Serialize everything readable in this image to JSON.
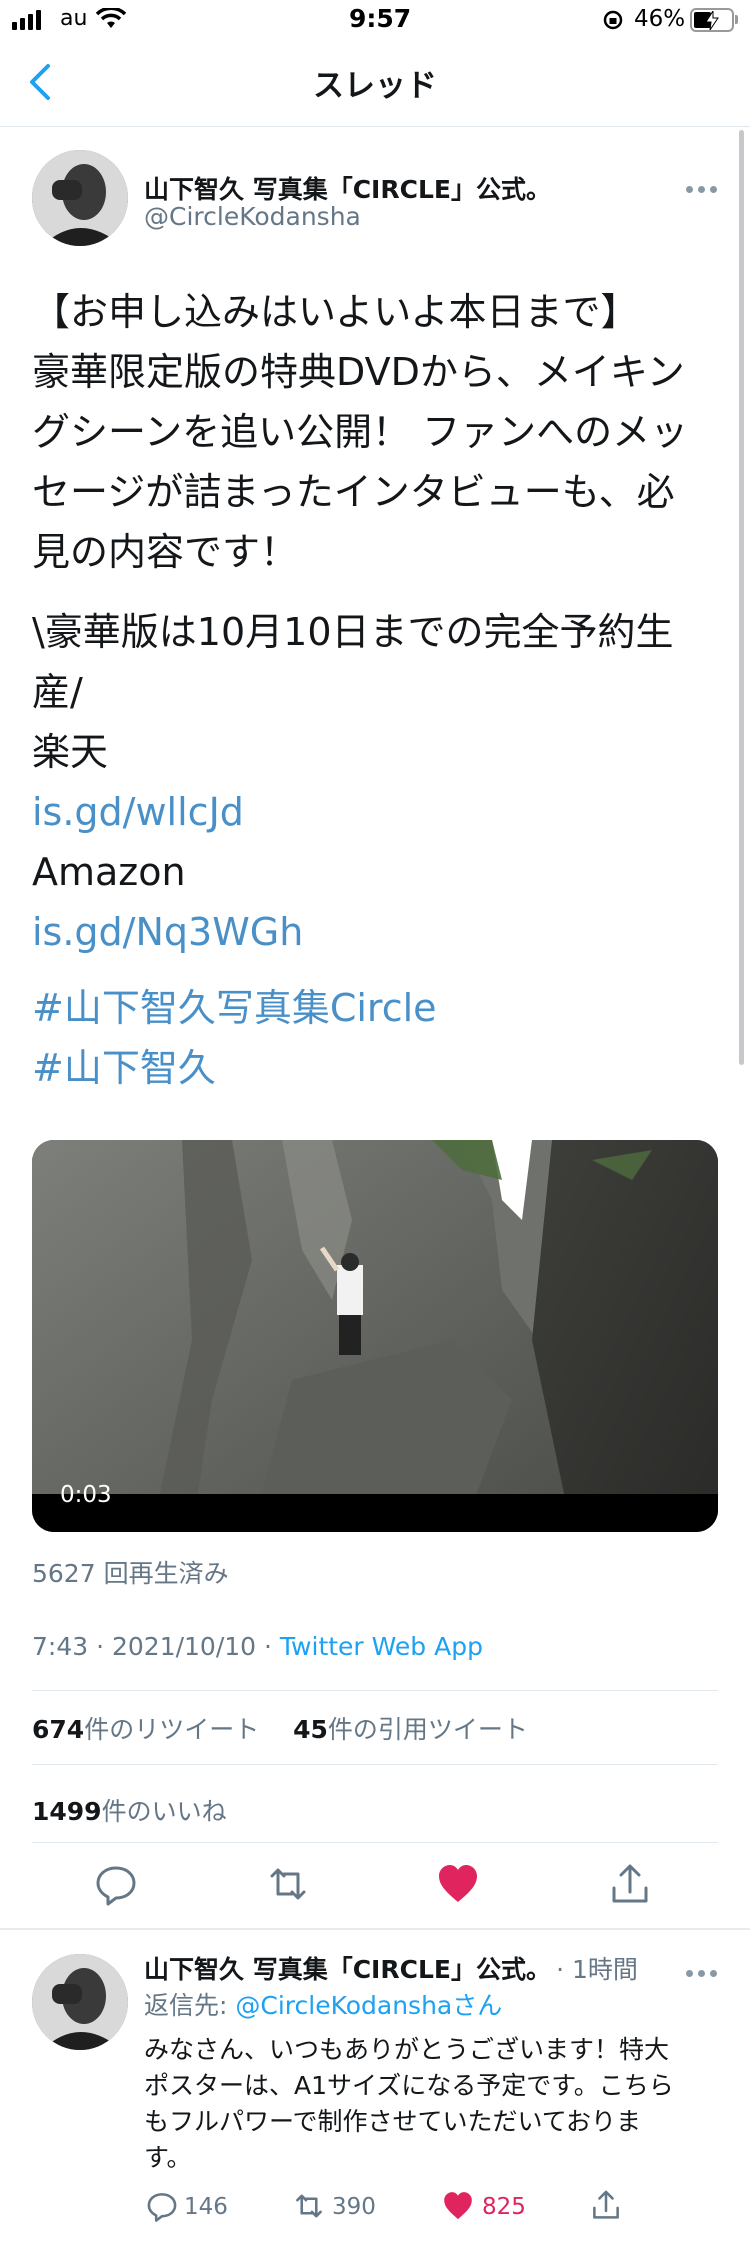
{
  "status_bar": {
    "carrier": "au",
    "time": "9:57",
    "battery_percent": "46%",
    "battery_level": 0.46
  },
  "nav": {
    "title": "スレッド"
  },
  "tweet": {
    "author_name": "山下智久 写真集「CIRCLE」公式。",
    "author_handle": "@CircleKodansha",
    "paragraph1": "【お申し込みはいよいよ本日まで】豪華限定版の特典DVDから、メイキングシーンを追い公開！ ファンへのメッセージが詰まったインタビューも、必見の内容です！",
    "para1_lines": [
      "【お申し込みはいよいよ本日まで】",
      "豪華限定版の特典DVDから、メイキン",
      "グシーンを追い公開！ ファンへのメッ",
      "セージが詰まったインタビューも、必",
      "見の内容です！"
    ],
    "paragraph2_lines": [
      "\\豪華版は10月10日までの完全予約生",
      "産/"
    ],
    "rakuten_label": "楽天",
    "rakuten_link": "is.gd/wllcJd",
    "amazon_label": "Amazon",
    "amazon_link": "is.gd/Nq3WGh",
    "hashtag1": "#山下智久写真集Circle",
    "hashtag2": "#山下智久",
    "video_time": "0:03",
    "views": "5627 回再生済み",
    "timestamp": "7:43 · 2021/10/10 · ",
    "client": "Twitter Web App",
    "retweets_count": "674",
    "retweets_label": "件のリツイート",
    "quotes_count": "45",
    "quotes_label": "件の引用ツイート",
    "likes_count": "1499",
    "likes_label": "件のいいね",
    "liked": true,
    "like_color": "#e0245e"
  },
  "reply": {
    "author_name": "山下智久 写真集「CIRCLE」公式。",
    "time_ago": "· 1時間",
    "replying_to_prefix": "返信先: ",
    "replying_to_handle": "@CircleKodansha",
    "replying_to_suffix": "さん",
    "text_lines": [
      "みなさん、いつもありがとうございます！特大",
      "ポスターは、A1サイズになる予定です。こちら",
      "もフルパワーで制作させていただいておりま",
      "す。"
    ],
    "reply_count": "146",
    "retweet_count": "390",
    "like_count": "825"
  }
}
